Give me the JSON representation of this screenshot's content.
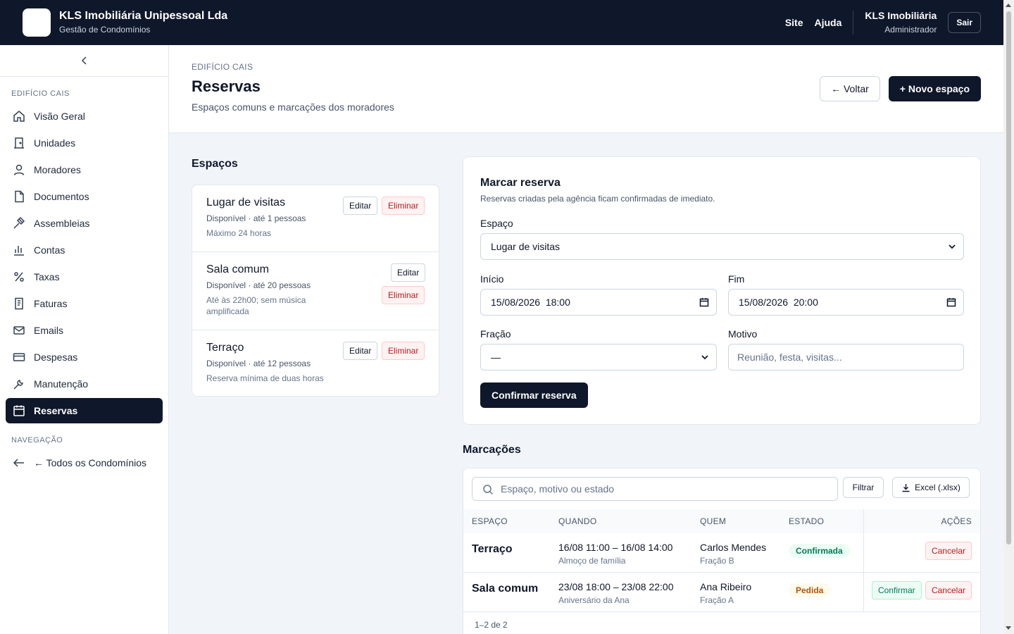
{
  "app": {
    "name": "KLS Imobiliária Unipessoal Lda",
    "subtitle": "Gestão de Condomínios",
    "links": [
      "Site",
      "Ajuda"
    ],
    "user_name": "KLS Imobiliária",
    "user_role": "Administrador",
    "logout": "Sair"
  },
  "sidebar": {
    "section_building": "EDIFÍCIO CAIS",
    "items": [
      {
        "label": "Visão Geral",
        "icon": "home-icon"
      },
      {
        "label": "Unidades",
        "icon": "door-icon"
      },
      {
        "label": "Moradores",
        "icon": "user-icon"
      },
      {
        "label": "Documentos",
        "icon": "file-icon"
      },
      {
        "label": "Assembleias",
        "icon": "gavel-icon"
      },
      {
        "label": "Contas",
        "icon": "bar-chart-icon"
      },
      {
        "label": "Taxas",
        "icon": "percent-icon"
      },
      {
        "label": "Faturas",
        "icon": "receipt-icon"
      },
      {
        "label": "Emails",
        "icon": "mail-icon"
      },
      {
        "label": "Despesas",
        "icon": "credit-card-icon"
      },
      {
        "label": "Manutenção",
        "icon": "wrench-icon"
      },
      {
        "label": "Reservas",
        "icon": "calendar-icon"
      }
    ],
    "section_nav": "NAVEGAÇÃO",
    "all_condos": "← Todos os Condomínios"
  },
  "header": {
    "breadcrumb": "EDIFÍCIO CAIS",
    "title": "Reservas",
    "subtitle": "Espaços comuns e marcações dos moradores",
    "back": "← Voltar",
    "new_space": "+ Novo espaço"
  },
  "spaces": {
    "title": "Espaços",
    "edit_label": "Editar",
    "delete_label": "Eliminar",
    "items": [
      {
        "name": "Lugar de visitas",
        "meta": "Disponível · até 1 pessoas",
        "note": "Máximo 24 horas"
      },
      {
        "name": "Sala comum",
        "meta": "Disponível · até 20 pessoas",
        "note": "Até às 22h00; sem música amplificada"
      },
      {
        "name": "Terraço",
        "meta": "Disponível · até 12 pessoas",
        "note": "Reserva mínima de duas horas"
      }
    ]
  },
  "form": {
    "title": "Marcar reserva",
    "subtitle": "Reservas criadas pela agência ficam confirmadas de imediato.",
    "space_label": "Espaço",
    "space_value": "Lugar de visitas",
    "start_label": "Início",
    "start_value": "15/08/2026  18:00",
    "end_label": "Fim",
    "end_value": "15/08/2026  20:00",
    "unit_label": "Fração",
    "unit_value": "—",
    "reason_label": "Motivo",
    "reason_placeholder": "Reunião, festa, visitas...",
    "submit": "Confirmar reserva"
  },
  "bookings": {
    "title": "Marcações",
    "search_placeholder": "Espaço, motivo ou estado",
    "filter": "Filtrar",
    "export": "Excel (.xlsx)",
    "columns": [
      "ESPAÇO",
      "QUANDO",
      "QUEM",
      "ESTADO",
      "AÇÕES"
    ],
    "rows": [
      {
        "space": "Terraço",
        "when": "16/08 11:00 – 16/08 14:00",
        "reason": "Almoço de família",
        "who": "Carlos Mendes",
        "unit": "Fração B",
        "status": "Confirmada",
        "actions": [
          "Cancelar"
        ]
      },
      {
        "space": "Sala comum",
        "when": "23/08 18:00 – 23/08 22:00",
        "reason": "Aniversário da Ana",
        "who": "Ana Ribeiro",
        "unit": "Fração A",
        "status": "Pedida",
        "actions": [
          "Confirmar",
          "Cancelar"
        ]
      }
    ],
    "pagination": "1–2 de 2"
  }
}
